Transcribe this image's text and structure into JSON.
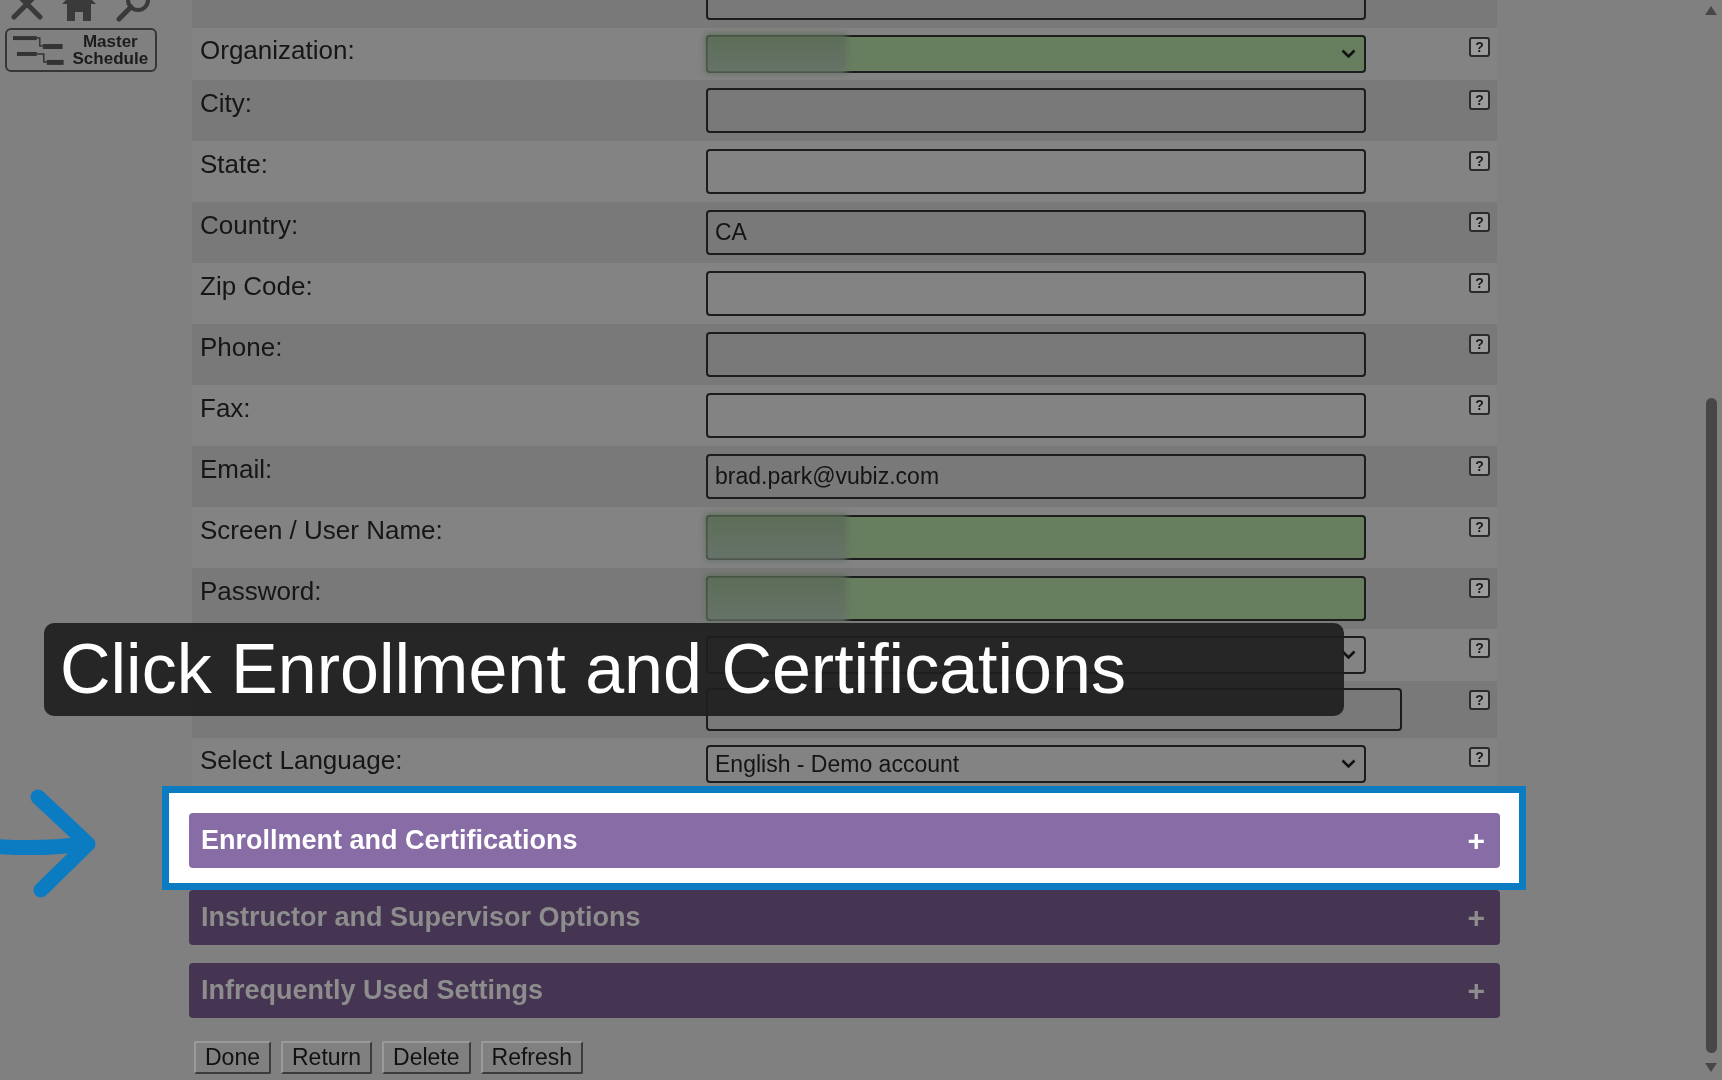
{
  "sidebar": {
    "master_schedule": {
      "label": "Master Schedule"
    }
  },
  "form": {
    "rows": [
      {
        "kind": "text",
        "autofilled": false,
        "redacted": false
      },
      {
        "kind": "select",
        "label": "Organization:",
        "autofilled": true,
        "redacted": true,
        "help": "?"
      },
      {
        "kind": "text",
        "label": "City:",
        "autofilled": false,
        "redacted": false,
        "help": "?"
      },
      {
        "kind": "text",
        "label": "State:",
        "autofilled": false,
        "redacted": false,
        "help": "?"
      },
      {
        "kind": "text",
        "label": "Country:",
        "value": "CA",
        "autofilled": false,
        "redacted": false,
        "help": "?"
      },
      {
        "kind": "text",
        "label": "Zip Code:",
        "autofilled": false,
        "redacted": false,
        "help": "?"
      },
      {
        "kind": "text",
        "label": "Phone:",
        "autofilled": false,
        "redacted": false,
        "help": "?"
      },
      {
        "kind": "text",
        "label": "Fax:",
        "autofilled": false,
        "redacted": false,
        "help": "?"
      },
      {
        "kind": "text",
        "label": "Email:",
        "value": "brad.park@vubiz.com",
        "autofilled": false,
        "redacted": false,
        "help": "?"
      },
      {
        "kind": "text",
        "label": "Screen / User Name:",
        "autofilled": true,
        "redacted": true,
        "help": "?"
      },
      {
        "kind": "text",
        "label": "Password:",
        "autofilled": true,
        "redacted": true,
        "help": "?"
      },
      {
        "kind": "select",
        "autofilled": false,
        "help": "?"
      },
      {
        "kind": "wide-text",
        "autofilled": false,
        "redacted": false,
        "help": "?"
      },
      {
        "kind": "select",
        "label": "Select Language:",
        "value": "English - Demo account",
        "autofilled": false,
        "redacted": false,
        "help": "?"
      }
    ]
  },
  "sections": [
    {
      "title": "Enrollment and Certifications",
      "toggle": "+",
      "spotlight": true
    },
    {
      "title": "Instructor and Supervisor Options",
      "toggle": "+",
      "spotlight": false
    },
    {
      "title": "Infrequently Used Settings",
      "toggle": "+",
      "spotlight": false
    }
  ],
  "buttons": [
    "Done",
    "Return",
    "Delete",
    "Refresh"
  ],
  "tutorial": {
    "caption": "Click Enrollment and Certifications"
  }
}
